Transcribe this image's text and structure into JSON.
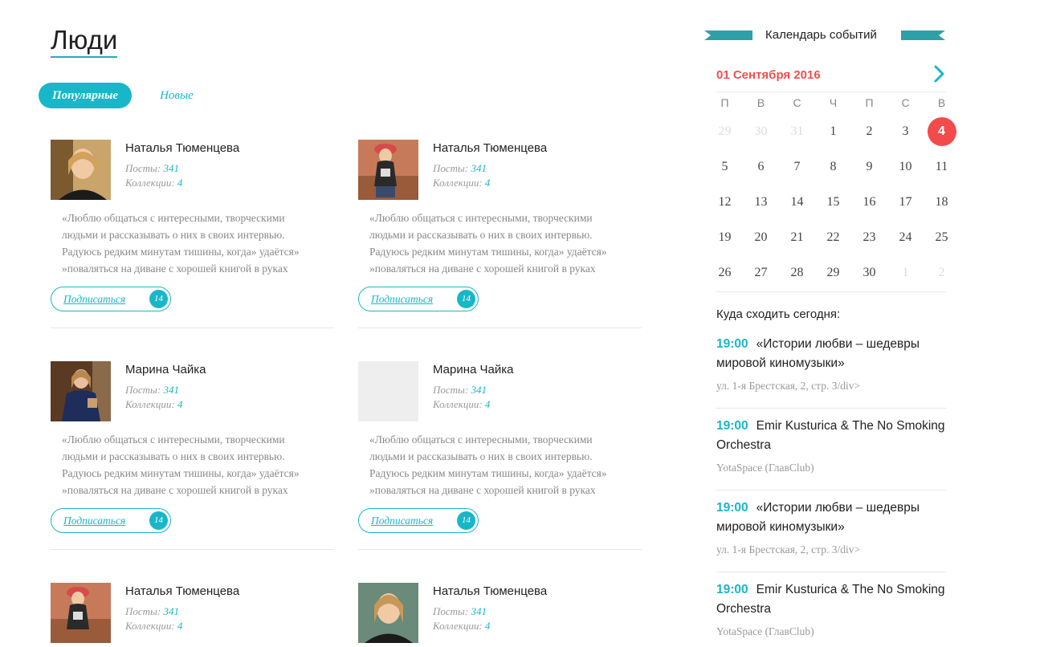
{
  "page": {
    "title": "Люди"
  },
  "tabs": [
    {
      "label": "Популярные",
      "active": true
    },
    {
      "label": "Новые",
      "active": false
    }
  ],
  "people": [
    {
      "name": "Наталья Тюменцева",
      "posts_label": "Посты:",
      "posts": "341",
      "collections_label": "Коллекции:",
      "collections": "4",
      "quote": [
        "«Люблю общаться с интересными, творческими",
        "людьми и рассказывать о них в своих интервью.",
        "Радуюсь редким минутам тишины, когда» удаётся»",
        "»поваляться на диване с хорошей книгой в руках"
      ],
      "subscribe_label": "Подписаться",
      "subscribe_count": "14"
    },
    {
      "name": "Наталья Тюменцева",
      "posts_label": "Посты:",
      "posts": "341",
      "collections_label": "Коллекции:",
      "collections": "4",
      "quote": [
        "«Люблю общаться с интересными, творческими",
        "людьми и рассказывать о них в своих интервью.",
        "Радуюсь редким минутам тишины, когда» удаётся»",
        "»поваляться на диване с хорошей книгой в руках"
      ],
      "subscribe_label": "Подписаться",
      "subscribe_count": "14"
    },
    {
      "name": "Марина Чайка",
      "posts_label": "Посты:",
      "posts": "341",
      "collections_label": "Коллекции:",
      "collections": "4",
      "quote": [
        "«Люблю общаться с интересными, творческими",
        "людьми и рассказывать о них в своих интервью.",
        "Радуюсь редким минутам тишины, когда» удаётся»",
        "»поваляться на диване с хорошей книгой в руках"
      ],
      "subscribe_label": "Подписаться",
      "subscribe_count": "14"
    },
    {
      "name": "Марина Чайка",
      "posts_label": "Посты:",
      "posts": "341",
      "collections_label": "Коллекции:",
      "collections": "4",
      "quote": [
        "«Люблю общаться с интересными, творческими",
        "людьми и рассказывать о них в своих интервью.",
        "Радуюсь редким минутам тишины, когда» удаётся»",
        "»поваляться на диване с хорошей книгой в руках"
      ],
      "subscribe_label": "Подписаться",
      "subscribe_count": "14"
    },
    {
      "name": "Наталья Тюменцева",
      "posts_label": "Посты:",
      "posts": "341",
      "collections_label": "Коллекции:",
      "collections": "4"
    },
    {
      "name": "Наталья Тюменцева",
      "posts_label": "Посты:",
      "posts": "341",
      "collections_label": "Коллекции:",
      "collections": "4"
    }
  ],
  "calendar": {
    "title": "Календарь событий",
    "month": "01 Сентября 2016",
    "weekdays": [
      "П",
      "В",
      "С",
      "Ч",
      "П",
      "С",
      "В"
    ],
    "days": [
      "29",
      "30",
      "31",
      "1",
      "2",
      "3",
      "4",
      "5",
      "6",
      "7",
      "8",
      "9",
      "10",
      "11",
      "12",
      "13",
      "14",
      "15",
      "16",
      "17",
      "18",
      "19",
      "20",
      "21",
      "22",
      "23",
      "24",
      "25",
      "26",
      "27",
      "28",
      "29",
      "30",
      "1",
      "2"
    ],
    "muted_days_indices": [
      0,
      1,
      2,
      33,
      34
    ],
    "today_index": 6
  },
  "events": {
    "title": "Куда сходить сегодня:",
    "items": [
      {
        "time": "19:00",
        "title": "«Истории любви – шедевры мировой киномузыки»",
        "location": "ул. 1-я Брестская, 2, стр. 3/div>"
      },
      {
        "time": "19:00",
        "title": "Emir Kusturica & The No Smoking Orchestra",
        "location": "YotaSpace (ГлавClub)"
      },
      {
        "time": "19:00",
        "title": "«Истории любви – шедевры мировой киномузыки»",
        "location": "ул. 1-я Брестская, 2, стр. 3/div>"
      },
      {
        "time": "19:00",
        "title": "Emir Kusturica & The No Smoking Orchestra",
        "location": "YotaSpace (ГлавClub)"
      }
    ]
  },
  "colors": {
    "accent": "#17b7c9",
    "today": "#f24b4b",
    "month": "#ee5050",
    "ribbon": "#2ea0a8"
  }
}
